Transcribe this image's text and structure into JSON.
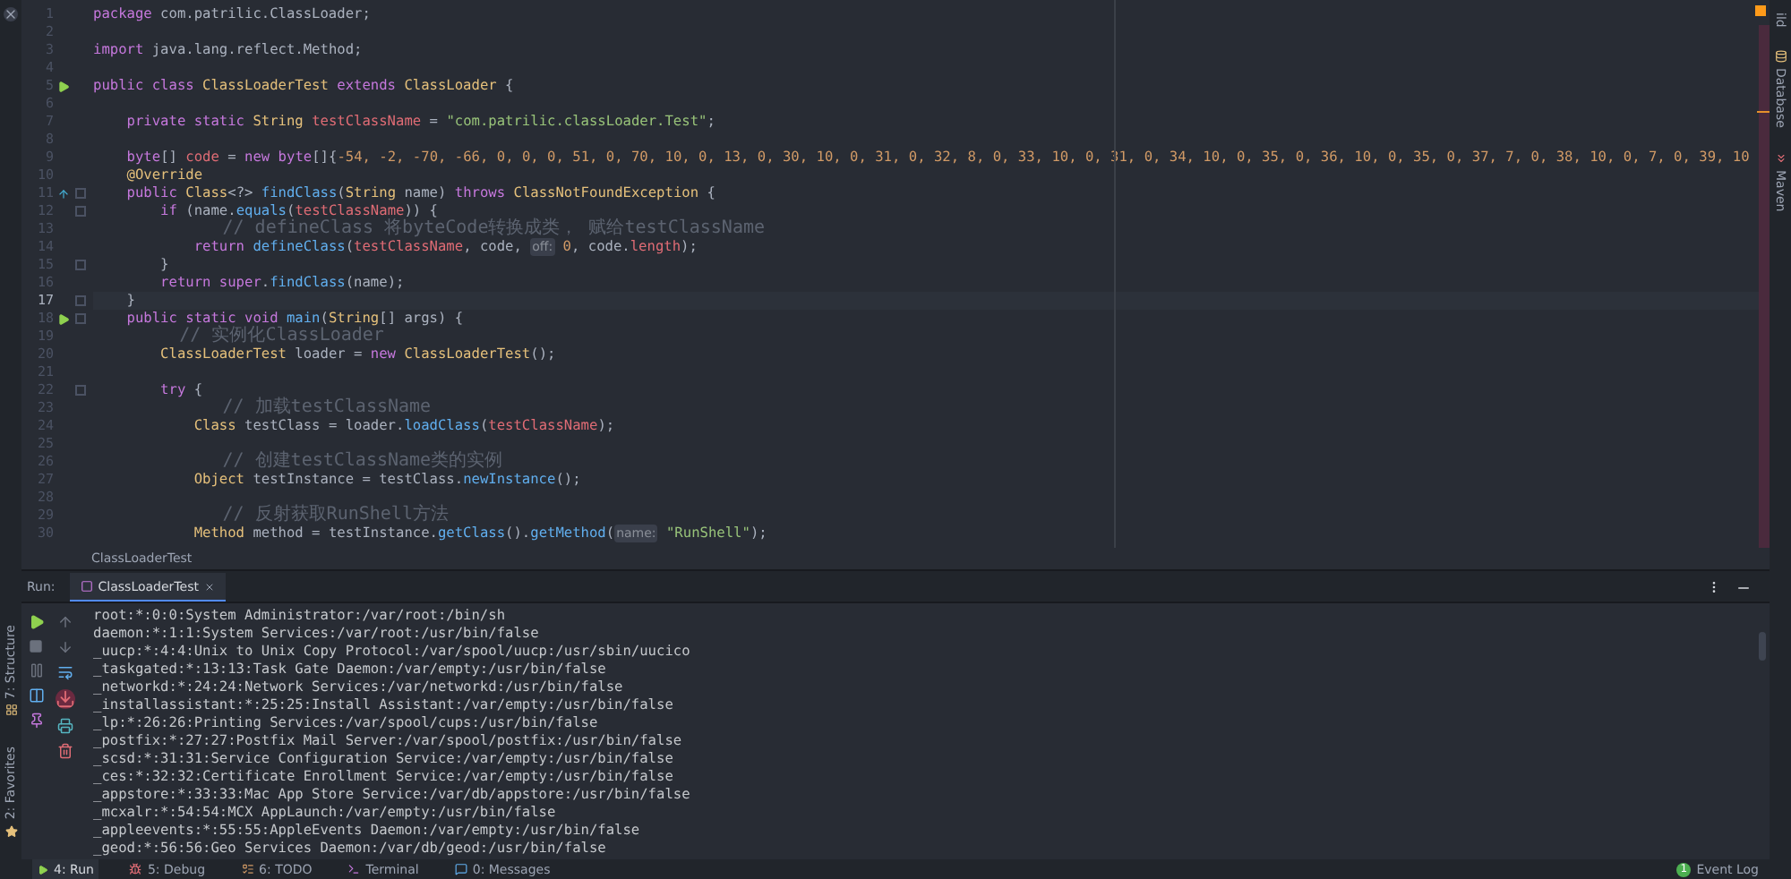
{
  "editor": {
    "lines": [
      {
        "number": "1",
        "segments": [
          {
            "t": "package",
            "kind": "kw"
          },
          {
            "t": " com.patrilic.ClassLoader;",
            "kind": "plain"
          }
        ]
      },
      {
        "number": "2"
      },
      {
        "number": "3",
        "segments": [
          {
            "t": "import",
            "kind": "kw"
          },
          {
            "t": " java.lang.reflect.Method;",
            "kind": "plain"
          }
        ]
      },
      {
        "number": "4"
      },
      {
        "number": "5",
        "gutter": {
          "kind": "run"
        },
        "segments": [
          {
            "t": "public class ",
            "kind": "kw"
          },
          {
            "t": "ClassLoaderTest",
            "kind": "type"
          },
          {
            "t": " extends ",
            "kind": "kw"
          },
          {
            "t": "ClassLoader",
            "kind": "type"
          },
          {
            "t": " {",
            "kind": "plain"
          }
        ]
      },
      {
        "number": "6"
      },
      {
        "number": "7",
        "segments": [
          {
            "t": "    private static ",
            "kind": "kw"
          },
          {
            "t": "String ",
            "kind": "type"
          },
          {
            "t": "testClassName",
            "kind": "field"
          },
          {
            "t": " = ",
            "kind": "plain"
          },
          {
            "t": "\"com.patrilic.classLoader.Test\"",
            "kind": "str"
          },
          {
            "t": ";",
            "kind": "plain"
          }
        ]
      },
      {
        "number": "8"
      },
      {
        "number": "9",
        "segments": [
          {
            "t": "    byte",
            "kind": "kw"
          },
          {
            "t": "[] ",
            "kind": "plain"
          },
          {
            "t": "code",
            "kind": "field"
          },
          {
            "t": " = ",
            "kind": "plain"
          },
          {
            "t": "new byte",
            "kind": "kw"
          },
          {
            "t": "[]{",
            "kind": "plain"
          },
          {
            "t": "-54, -2, -70, -66, 0, 0, 0, 51, 0, 70, 10, 0, 13, 0, 30, 10, 0, 31, 0, 32, 8, 0, 33, 10, 0, 31, 0, 34, 10, 0, 35, 0, 36, 10, 0, 35, 0, 37, 7, 0, 38, 10, 0, 7, 0, 39, 10",
            "kind": "num"
          }
        ]
      },
      {
        "number": "10",
        "segments": [
          {
            "t": "    @Override",
            "kind": "ann"
          }
        ]
      },
      {
        "number": "11",
        "gutter": {
          "kind": "override"
        },
        "fold": true,
        "segments": [
          {
            "t": "    public ",
            "kind": "kw"
          },
          {
            "t": "Class",
            "kind": "type"
          },
          {
            "t": "<?> ",
            "kind": "plain"
          },
          {
            "t": "findClass",
            "kind": "fn"
          },
          {
            "t": "(",
            "kind": "plain"
          },
          {
            "t": "String",
            "kind": "type"
          },
          {
            "t": " name) ",
            "kind": "plain"
          },
          {
            "t": "throws ",
            "kind": "kw"
          },
          {
            "t": "ClassNotFoundException",
            "kind": "type"
          },
          {
            "t": " {",
            "kind": "plain"
          }
        ]
      },
      {
        "number": "12",
        "fold": true,
        "segments": [
          {
            "t": "        if",
            "kind": "kw"
          },
          {
            "t": " (name.",
            "kind": "plain"
          },
          {
            "t": "equals",
            "kind": "fn"
          },
          {
            "t": "(",
            "kind": "plain"
          },
          {
            "t": "testClassName",
            "kind": "field"
          },
          {
            "t": ")) {",
            "kind": "plain"
          }
        ]
      },
      {
        "number": "13",
        "segments": [
          {
            "t": "            // defineClass 将byteCode转换成类， 赋给testClassName",
            "kind": "cmt"
          }
        ]
      },
      {
        "number": "14",
        "segments": [
          {
            "t": "            return ",
            "kind": "kw"
          },
          {
            "t": "defineClass",
            "kind": "fn"
          },
          {
            "t": "(",
            "kind": "plain"
          },
          {
            "t": "testClassName",
            "kind": "field"
          },
          {
            "t": ", code, ",
            "kind": "plain"
          },
          {
            "t": "off:",
            "kind": "hint"
          },
          {
            "t": " 0",
            "kind": "num"
          },
          {
            "t": ", code.",
            "kind": "plain"
          },
          {
            "t": "length",
            "kind": "field"
          },
          {
            "t": ");",
            "kind": "plain"
          }
        ]
      },
      {
        "number": "15",
        "fold": true,
        "segments": [
          {
            "t": "        }",
            "kind": "plain"
          }
        ]
      },
      {
        "number": "16",
        "segments": [
          {
            "t": "        return super",
            "kind": "kw"
          },
          {
            "t": ".",
            "kind": "plain"
          },
          {
            "t": "findClass",
            "kind": "fn"
          },
          {
            "t": "(name);",
            "kind": "plain"
          }
        ]
      },
      {
        "number": "17",
        "fold": true,
        "current": true,
        "segments": [
          {
            "t": "    }",
            "kind": "plain"
          }
        ]
      },
      {
        "number": "18",
        "gutter": {
          "kind": "run"
        },
        "fold": true,
        "segments": [
          {
            "t": "    public static void ",
            "kind": "kw"
          },
          {
            "t": "main",
            "kind": "fn"
          },
          {
            "t": "(",
            "kind": "plain"
          },
          {
            "t": "String",
            "kind": "type"
          },
          {
            "t": "[] args) {",
            "kind": "plain"
          }
        ]
      },
      {
        "number": "19",
        "segments": [
          {
            "t": "        // 实例化ClassLoader",
            "kind": "cmt"
          }
        ]
      },
      {
        "number": "20",
        "segments": [
          {
            "t": "        ClassLoaderTest",
            "kind": "type"
          },
          {
            "t": " loader = ",
            "kind": "plain"
          },
          {
            "t": "new ",
            "kind": "kw"
          },
          {
            "t": "ClassLoaderTest",
            "kind": "type"
          },
          {
            "t": "();",
            "kind": "plain"
          }
        ]
      },
      {
        "number": "21"
      },
      {
        "number": "22",
        "fold": true,
        "segments": [
          {
            "t": "        try",
            "kind": "kw"
          },
          {
            "t": " {",
            "kind": "plain"
          }
        ]
      },
      {
        "number": "23",
        "segments": [
          {
            "t": "            // 加载testClassName",
            "kind": "cmt"
          }
        ]
      },
      {
        "number": "24",
        "segments": [
          {
            "t": "            Class",
            "kind": "type"
          },
          {
            "t": " testClass = loader.",
            "kind": "plain"
          },
          {
            "t": "loadClass",
            "kind": "fn"
          },
          {
            "t": "(",
            "kind": "plain"
          },
          {
            "t": "testClassName",
            "kind": "field"
          },
          {
            "t": ");",
            "kind": "plain"
          }
        ]
      },
      {
        "number": "25"
      },
      {
        "number": "26",
        "segments": [
          {
            "t": "            // 创建testClassName类的实例",
            "kind": "cmt"
          }
        ]
      },
      {
        "number": "27",
        "segments": [
          {
            "t": "            Object",
            "kind": "type"
          },
          {
            "t": " testInstance = testClass.",
            "kind": "plain"
          },
          {
            "t": "newInstance",
            "kind": "fn"
          },
          {
            "t": "();",
            "kind": "plain"
          }
        ]
      },
      {
        "number": "28"
      },
      {
        "number": "29",
        "segments": [
          {
            "t": "            // 反射获取RunShell方法",
            "kind": "cmt"
          }
        ]
      },
      {
        "number": "30",
        "segments": [
          {
            "t": "            Method",
            "kind": "type"
          },
          {
            "t": " method = testInstance.",
            "kind": "plain"
          },
          {
            "t": "getClass",
            "kind": "fn"
          },
          {
            "t": "().",
            "kind": "plain"
          },
          {
            "t": "getMethod",
            "kind": "fn"
          },
          {
            "t": "(",
            "kind": "plain"
          },
          {
            "t": "name:",
            "kind": "hint"
          },
          {
            "t": " \"RunShell\"",
            "kind": "str"
          },
          {
            "t": ");",
            "kind": "plain"
          }
        ]
      }
    ],
    "breadcrumb": "ClassLoaderTest"
  },
  "right_toolbar": [
    {
      "label": "ild",
      "kind": "build"
    },
    {
      "label": "Database",
      "kind": "database"
    },
    {
      "label": "Maven",
      "kind": "maven"
    }
  ],
  "left_toolbar": [
    {
      "label": "7: Structure",
      "kind": "structure"
    },
    {
      "label": "2: Favorites",
      "kind": "favorites"
    }
  ],
  "run_panel": {
    "label": "Run:",
    "tabs": [
      {
        "label": "ClassLoaderTest",
        "selected": true
      }
    ],
    "output": [
      "root:*:0:0:System Administrator:/var/root:/bin/sh",
      "daemon:*:1:1:System Services:/var/root:/usr/bin/false",
      "_uucp:*:4:4:Unix to Unix Copy Protocol:/var/spool/uucp:/usr/sbin/uucico",
      "_taskgated:*:13:13:Task Gate Daemon:/var/empty:/usr/bin/false",
      "_networkd:*:24:24:Network Services:/var/networkd:/usr/bin/false",
      "_installassistant:*:25:25:Install Assistant:/var/empty:/usr/bin/false",
      "_lp:*:26:26:Printing Services:/var/spool/cups:/usr/bin/false",
      "_postfix:*:27:27:Postfix Mail Server:/var/spool/postfix:/usr/bin/false",
      "_scsd:*:31:31:Service Configuration Service:/var/empty:/usr/bin/false",
      "_ces:*:32:32:Certificate Enrollment Service:/var/empty:/usr/bin/false",
      "_appstore:*:33:33:Mac App Store Service:/var/db/appstore:/usr/bin/false",
      "_mcxalr:*:54:54:MCX AppLaunch:/var/empty:/usr/bin/false",
      "_appleevents:*:55:55:AppleEvents Daemon:/var/empty:/usr/bin/false",
      "_geod:*:56:56:Geo Services Daemon:/var/db/geod:/usr/bin/false"
    ]
  },
  "status_bar": {
    "tabs": [
      {
        "label": "4: Run",
        "kind": "run",
        "selected": true
      },
      {
        "label": "5: Debug",
        "kind": "debug",
        "selected": false
      },
      {
        "label": "6: TODO",
        "kind": "todo",
        "selected": false
      },
      {
        "label": "Terminal",
        "kind": "terminal",
        "selected": false
      },
      {
        "label": "0: Messages",
        "kind": "messages",
        "selected": false
      }
    ],
    "event_log": {
      "count": "1",
      "label": "Event Log"
    }
  }
}
